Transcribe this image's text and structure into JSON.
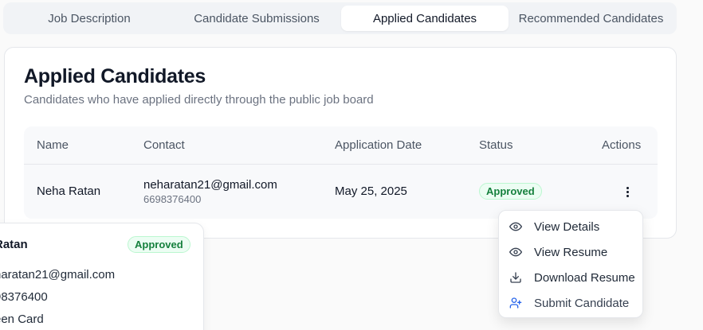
{
  "tabs": [
    {
      "label": "Job Description"
    },
    {
      "label": "Candidate Submissions"
    },
    {
      "label": "Applied Candidates"
    },
    {
      "label": "Recommended Candidates"
    }
  ],
  "card": {
    "title": "Applied Candidates",
    "subtitle": "Candidates who have applied directly through the public job board"
  },
  "table": {
    "headers": [
      "Name",
      "Contact",
      "Application Date",
      "Status",
      "Actions"
    ],
    "rows": [
      {
        "name": "Neha Ratan",
        "email": "neharatan21@gmail.com",
        "phone": "6698376400",
        "date": "May 25, 2025",
        "status": "Approved"
      }
    ]
  },
  "menu": {
    "items": [
      {
        "label": "View Details",
        "icon": "eye-icon"
      },
      {
        "label": "View Resume",
        "icon": "eye-icon"
      },
      {
        "label": "Download Resume",
        "icon": "download-icon"
      },
      {
        "label": "Submit Candidate",
        "icon": "user-plus-icon"
      }
    ]
  },
  "preview": {
    "name": "Ratan",
    "status": "Approved",
    "email": "haratan21@gmail.com",
    "phone": "98376400",
    "extra": "een Card"
  },
  "colors": {
    "accent_blue": "#2563eb",
    "approved_green": "#15803d"
  }
}
